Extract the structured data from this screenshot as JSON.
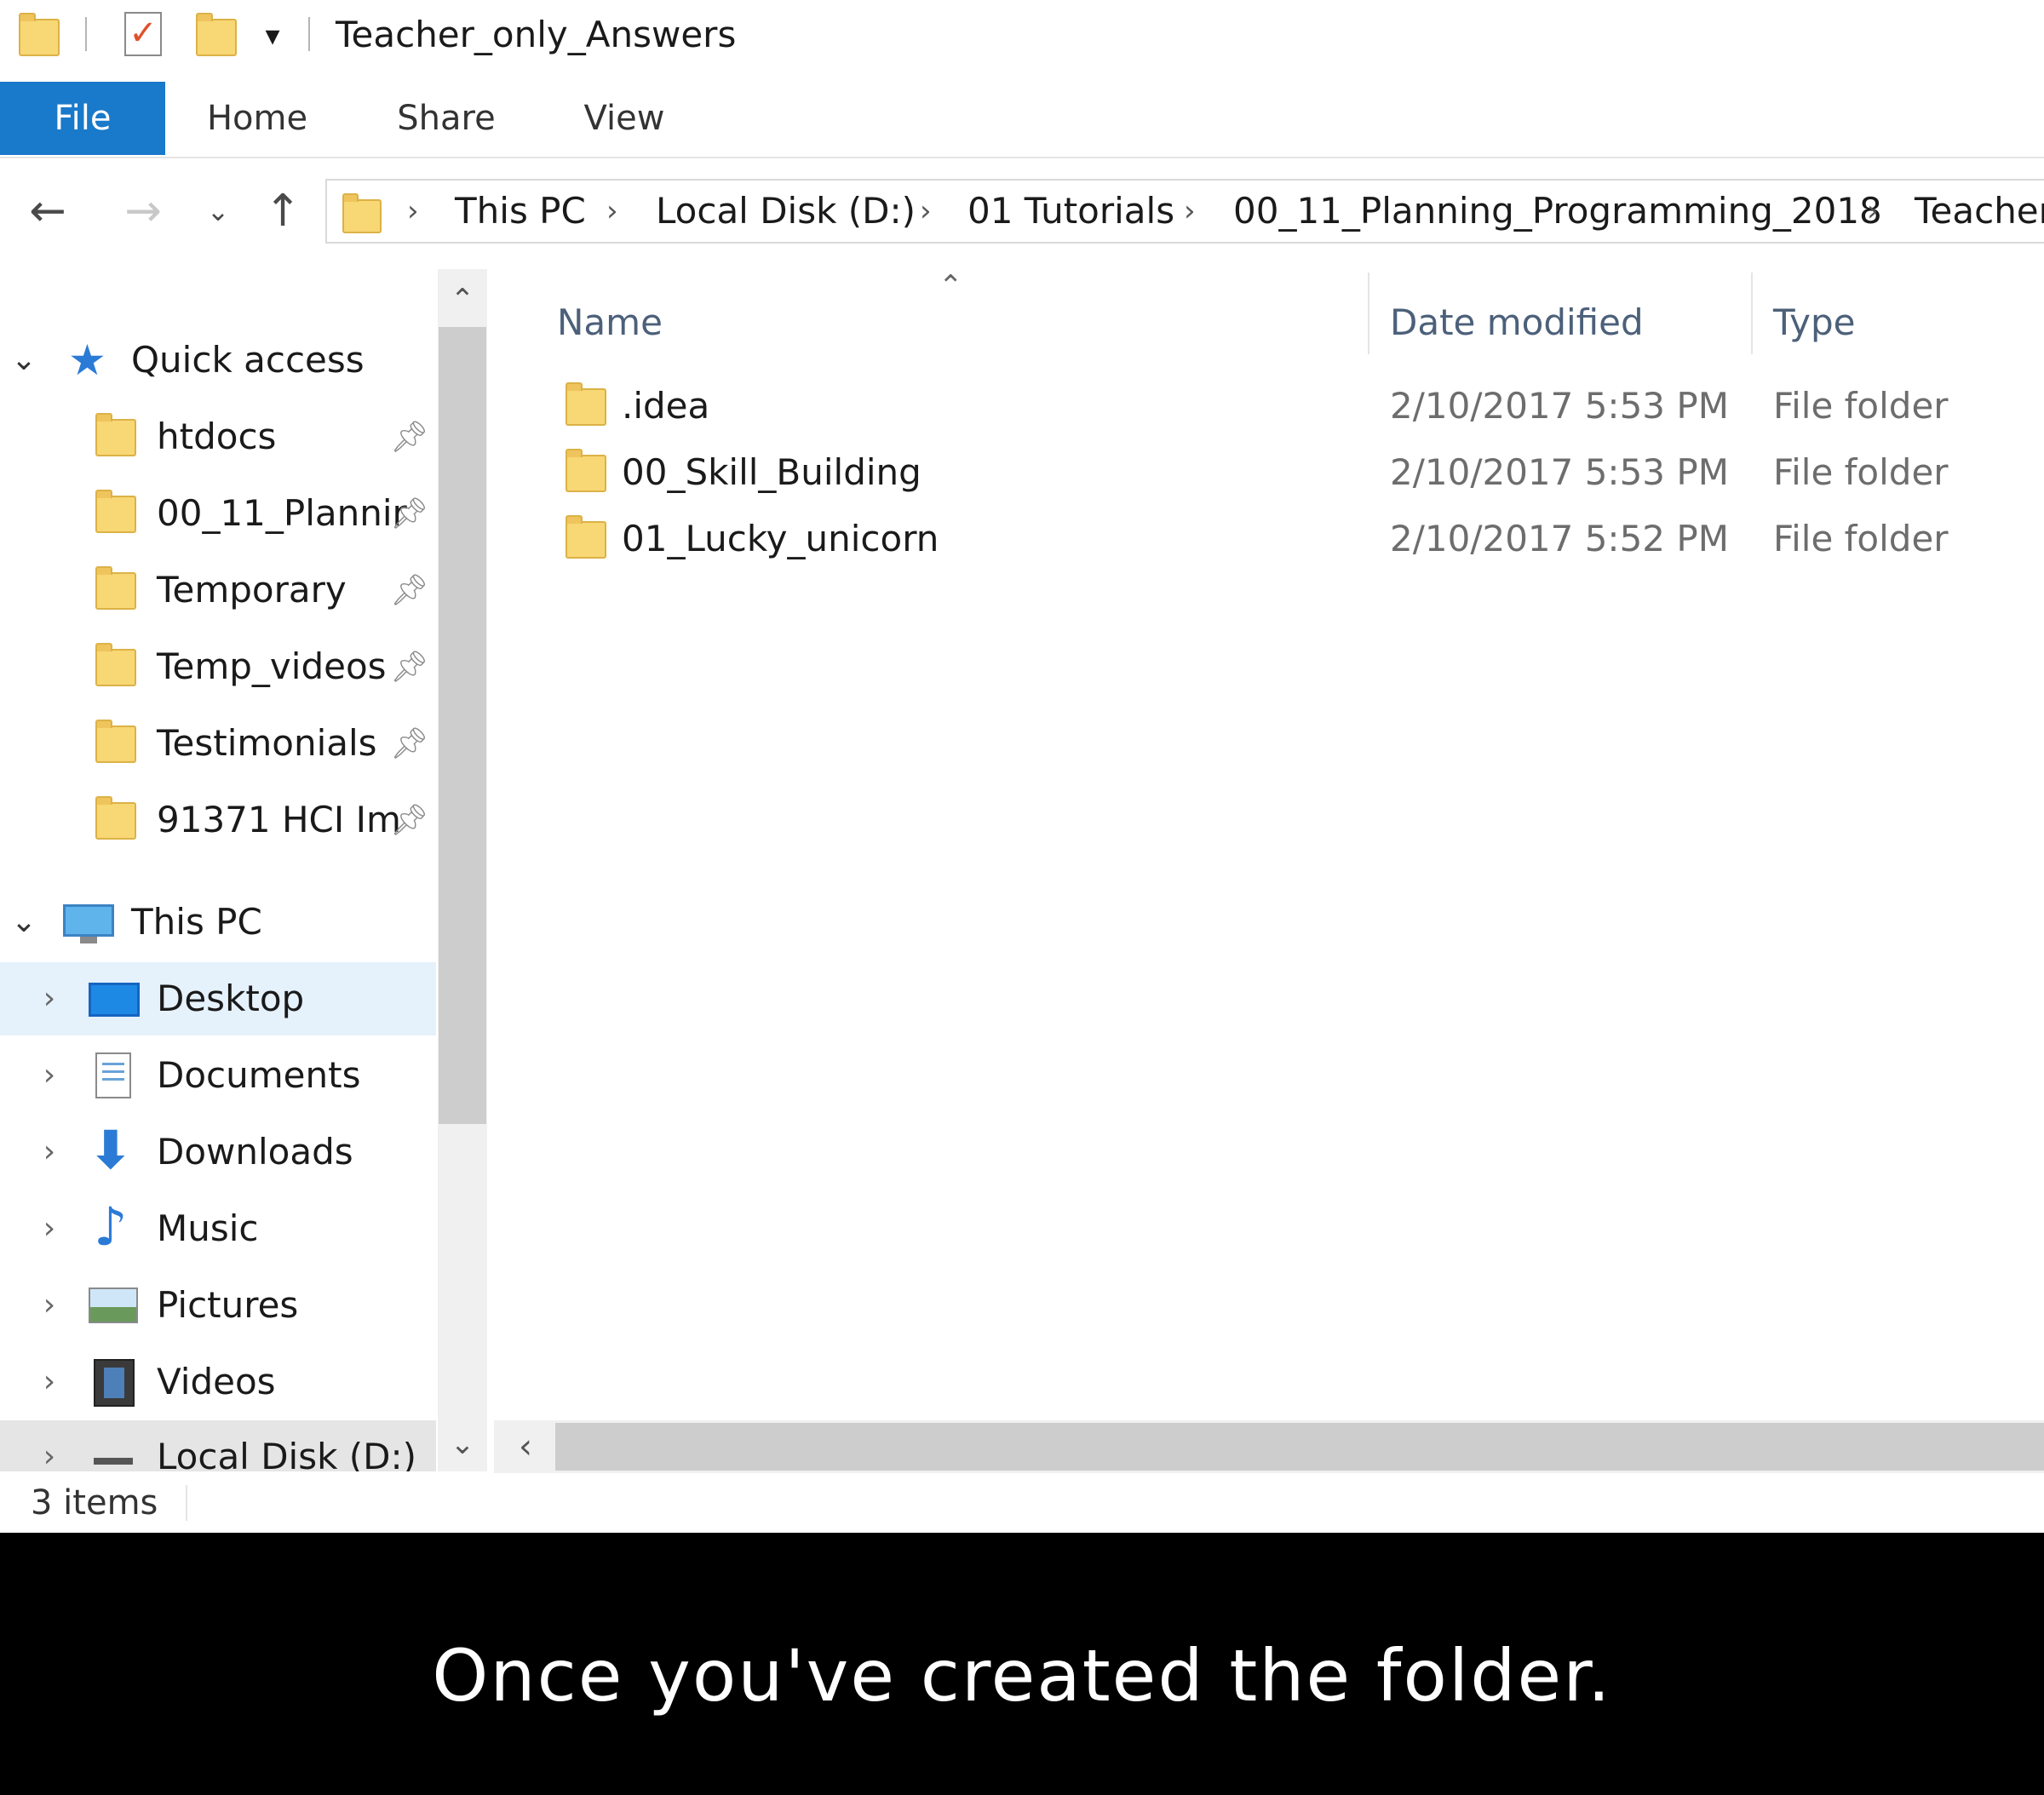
{
  "window": {
    "title": "Teacher_only_Answers"
  },
  "ribbon": {
    "tabs": [
      "File",
      "Home",
      "Share",
      "View"
    ]
  },
  "address": {
    "crumbs": [
      "This PC",
      "Local Disk (D:)",
      "01 Tutorials",
      "00_11_Planning_Programming_2018",
      "Teacher_only_Answers"
    ]
  },
  "nav": {
    "quick_access": {
      "label": "Quick access"
    },
    "pinned": [
      "htdocs",
      "00_11_Plannir",
      "Temporary",
      "Temp_videos",
      "Testimonials",
      "91371 HCI Im"
    ],
    "this_pc": {
      "label": "This PC"
    },
    "pc_items": [
      "Desktop",
      "Documents",
      "Downloads",
      "Music",
      "Pictures",
      "Videos",
      "Local Disk (D:)"
    ]
  },
  "columns": {
    "name": "Name",
    "date": "Date modified",
    "type": "Type"
  },
  "files": [
    {
      "name": ".idea",
      "date": "2/10/2017 5:53 PM",
      "type": "File folder"
    },
    {
      "name": "00_Skill_Building",
      "date": "2/10/2017 5:53 PM",
      "type": "File folder"
    },
    {
      "name": "01_Lucky_unicorn",
      "date": "2/10/2017 5:52 PM",
      "type": "File folder"
    }
  ],
  "status": {
    "items": "3 items"
  },
  "caption": {
    "text": "Once you've created the folder."
  },
  "icons": {
    "quick_access": "star-icon",
    "this_pc": "monitor-icon",
    "desktop": "desktop-icon",
    "documents": "document-icon",
    "downloads": "download-arrow-icon",
    "music": "music-note-icon",
    "pictures": "picture-icon",
    "videos": "film-icon",
    "local_disk": "drive-icon"
  },
  "colors": {
    "file_tab": "#1979ca",
    "selected_row": "#e5f1fb",
    "folder": "#f8d775",
    "column_header": "#4c607a"
  }
}
